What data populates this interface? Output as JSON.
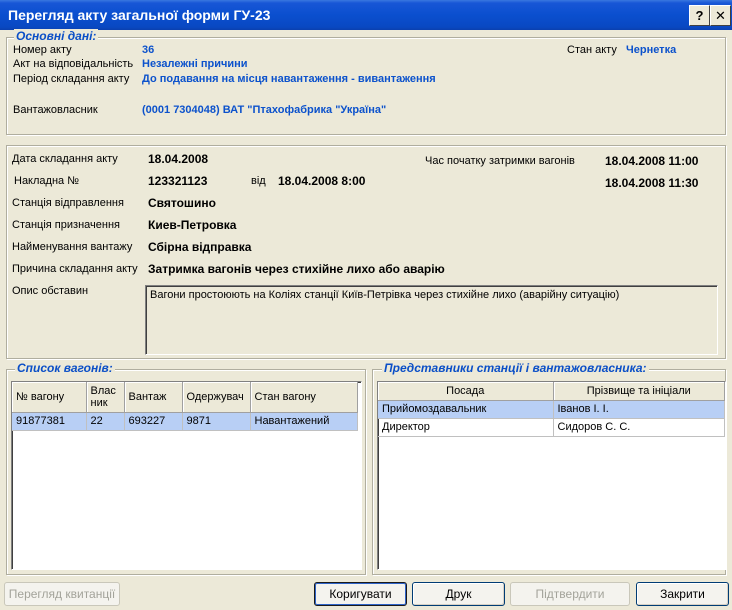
{
  "window": {
    "title": "Перегляд акту загальної форми ГУ-23",
    "help_glyph": "?",
    "close_glyph": "✕"
  },
  "main_data": {
    "legend": "Основні дані:",
    "act_number_label": "Номер акту",
    "act_number": "36",
    "responsibility_label": "Акт на відповідальність",
    "responsibility": "Незалежні причини",
    "period_label": "Період складання акту",
    "period": "До подавання на місця навантаження - вивантаження",
    "owner_label": "Вантажовласник",
    "owner": "(0001 7304048) ВАТ \"Птахофабрика \"Україна\"",
    "state_label": "Стан акту",
    "state": "Чернетка"
  },
  "details": {
    "date_label": "Дата складання акту",
    "date": "18.04.2008",
    "waybill_label": "Накладна №",
    "waybill": "123321123",
    "from_label": "від",
    "waybill_date": "18.04.2008 8:00",
    "delay_label": "Час початку затримки вагонів",
    "delay_start": "18.04.2008 11:00",
    "delay_end": "18.04.2008 11:30",
    "departure_label": "Станція відправлення",
    "departure": "Святошино",
    "destination_label": "Станція призначення",
    "destination": "Киев-Петровка",
    "cargo_label": "Найменування вантажу",
    "cargo": "Сбірна відправка",
    "reason_label": "Причина складання акту",
    "reason": "Затримка вагонів через стихійне лихо або аварію",
    "description_label": "Опис обставин",
    "description": "Вагони простоюють на Коліях станції Київ-Петрівка через стихійне лихо (аварійну ситуацію)"
  },
  "wagons": {
    "legend": "Список вагонів:",
    "columns": [
      "№ вагону",
      "Влас ник",
      "Вантаж",
      "Одержувач",
      "Стан вагону"
    ],
    "rows": [
      [
        "91877381",
        "22",
        "693227",
        "9871",
        "Навантажений"
      ]
    ]
  },
  "reps": {
    "legend": "Представники станції і вантажовласника:",
    "columns": [
      "Посада",
      "Прізвище та ініціали"
    ],
    "rows": [
      [
        "Прийомоздавальник",
        "Іванов І. І."
      ],
      [
        "Директор",
        "Сидоров С. С."
      ]
    ]
  },
  "buttons": {
    "receipt": "Перегляд квитанції",
    "edit": "Коригувати",
    "print": "Друк",
    "confirm": "Підтвердити",
    "close": "Закрити"
  }
}
